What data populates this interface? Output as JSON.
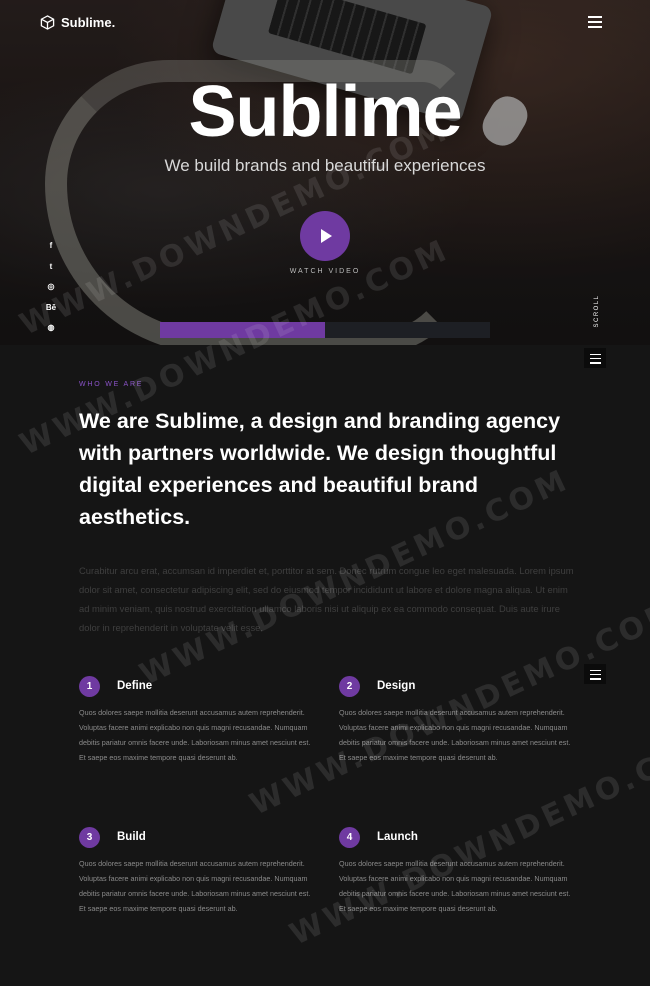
{
  "brand": {
    "name": "Sublime."
  },
  "hero": {
    "title": "Sublime",
    "subtitle": "We build brands and beautiful experiences",
    "video_label": "WATCH VIDEO",
    "progress": 0.5
  },
  "social": [
    {
      "icon": "facebook-icon",
      "glyph": "f"
    },
    {
      "icon": "twitter-icon",
      "glyph": "t"
    },
    {
      "icon": "instagram-icon",
      "glyph": "◎"
    },
    {
      "icon": "behance-icon",
      "glyph": "Bē"
    },
    {
      "icon": "dribbble-icon",
      "glyph": "◍"
    }
  ],
  "scroll_label": "SCROLL",
  "about": {
    "eyebrow": "WHO WE ARE",
    "headline": "We are Sublime, a design and branding agency with partners worldwide. We design thoughtful digital experiences and beautiful brand aesthetics.",
    "body": "Curabitur arcu erat, accumsan id imperdiet et, porttitor at sem. Donec rutrum congue leo eget malesuada. Lorem ipsum dolor sit amet, consectetur adipiscing elit, sed do eiusmod tempor incididunt ut labore et dolore magna aliqua. Ut enim ad minim veniam, quis nostrud exercitation ullamco laboris nisi ut aliquip ex ea commodo consequat. Duis aute irure dolor in reprehenderit in voluptate velit esse."
  },
  "features": [
    {
      "num": "1",
      "title": "Define",
      "body": "Quos dolores saepe mollitia deserunt accusamus autem reprehenderit. Voluptas facere animi explicabo non quis magni recusandae. Numquam debitis pariatur omnis facere unde. Laboriosam minus amet nesciunt est. Et saepe eos maxime tempore quasi deserunt ab."
    },
    {
      "num": "2",
      "title": "Design",
      "body": "Quos dolores saepe mollitia deserunt accusamus autem reprehenderit. Voluptas facere animi explicabo non quis magni recusandae. Numquam debitis pariatur omnis facere unde. Laboriosam minus amet nesciunt est. Et saepe eos maxime tempore quasi deserunt ab."
    },
    {
      "num": "3",
      "title": "Build",
      "body": "Quos dolores saepe mollitia deserunt accusamus autem reprehenderit. Voluptas facere animi explicabo non quis magni recusandae. Numquam debitis pariatur omnis facere unde. Laboriosam minus amet nesciunt est. Et saepe eos maxime tempore quasi deserunt ab."
    },
    {
      "num": "4",
      "title": "Launch",
      "body": "Quos dolores saepe mollitia deserunt accusamus autem reprehenderit. Voluptas facere animi explicabo non quis magni recusandae. Numquam debitis pariatur omnis facere unde. Laboriosam minus amet nesciunt est. Et saepe eos maxime tempore quasi deserunt ab."
    }
  ],
  "watermark": "WWW.DOWNDEMO.COM",
  "colors": {
    "accent": "#6f3aa1",
    "background": "#151515",
    "progress_track": "#1d1f24"
  }
}
